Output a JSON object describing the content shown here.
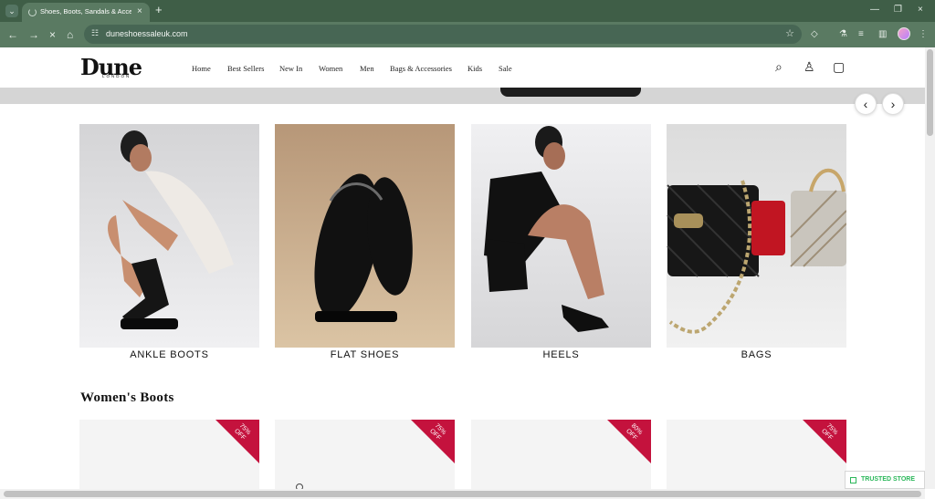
{
  "browser": {
    "tab_title": "Shoes, Boots, Sandals & Accessories",
    "url": "duneshoessaleuk.com",
    "icons": [
      "tab-search-icon",
      "loading-spinner-icon",
      "close-icon",
      "plus-icon",
      "back-icon",
      "forward-icon",
      "stop-icon",
      "home-icon",
      "site-info-icon",
      "bookmark-star-icon",
      "extensions-icon",
      "labs-icon",
      "media-icon",
      "sidebar-icon",
      "profile-icon",
      "menu-icon"
    ]
  },
  "header": {
    "logo": "Dune",
    "logo_sub": "LONDON",
    "nav": [
      "Home",
      "Best Sellers",
      "New In",
      "Women",
      "Men",
      "Bags & Accessories",
      "Kids",
      "Sale"
    ],
    "icons": [
      "search-icon",
      "account-icon",
      "bag-icon"
    ]
  },
  "carousel": {
    "prev": "‹",
    "next": "›"
  },
  "categories": [
    "ANKLE BOOTS",
    "FLAT SHOES",
    "HEELS",
    "BAGS"
  ],
  "section": {
    "title": "Women's Boots"
  },
  "products": [
    {
      "badge": "75% OFF"
    },
    {
      "badge": "75% OFF"
    },
    {
      "badge": "80% OFF"
    },
    {
      "badge": "75% OFF"
    }
  ],
  "trusted_store": "TRUSTED STORE",
  "colors": {
    "browser_frame": "#3f5e47",
    "sale_badge": "#c4123d",
    "trusted_green": "#2bb75a"
  }
}
